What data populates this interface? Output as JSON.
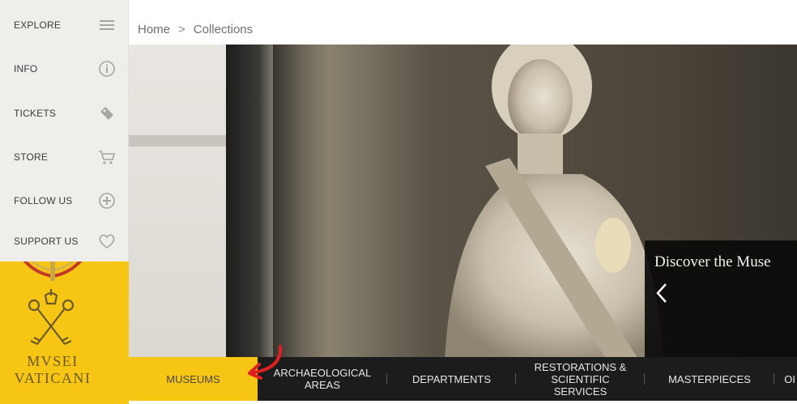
{
  "sidebar": {
    "items": [
      {
        "label": "EXPLORE",
        "icon": "menu-icon"
      },
      {
        "label": "INFO",
        "icon": "info-icon"
      },
      {
        "label": "TICKETS",
        "icon": "ticket-icon"
      },
      {
        "label": "STORE",
        "icon": "cart-icon"
      },
      {
        "label": "FOLLOW US",
        "icon": "plus-circle-icon"
      },
      {
        "label": "SUPPORT US",
        "icon": "heart-icon"
      }
    ]
  },
  "logo": {
    "line1": "MVSEI",
    "line2": "VATICANI"
  },
  "breadcrumb": {
    "home": "Home",
    "separator": ">",
    "current": "Collections"
  },
  "hero": {
    "caption_title": "Discover the Muse"
  },
  "nav": {
    "items": [
      {
        "label": "MUSEUMS"
      },
      {
        "label": "ARCHAEOLOGICAL AREAS"
      },
      {
        "label": "DEPARTMENTS"
      },
      {
        "label": "RESTORATIONS & SCIENTIFIC SERVICES"
      },
      {
        "label": "MASTERPIECES"
      },
      {
        "label": "OI"
      }
    ]
  },
  "colors": {
    "accent_yellow": "#f7c514",
    "sidebar_bg": "#efeeeb",
    "nav_bg": "#1c1c1c",
    "annotation_red": "#e02020"
  }
}
